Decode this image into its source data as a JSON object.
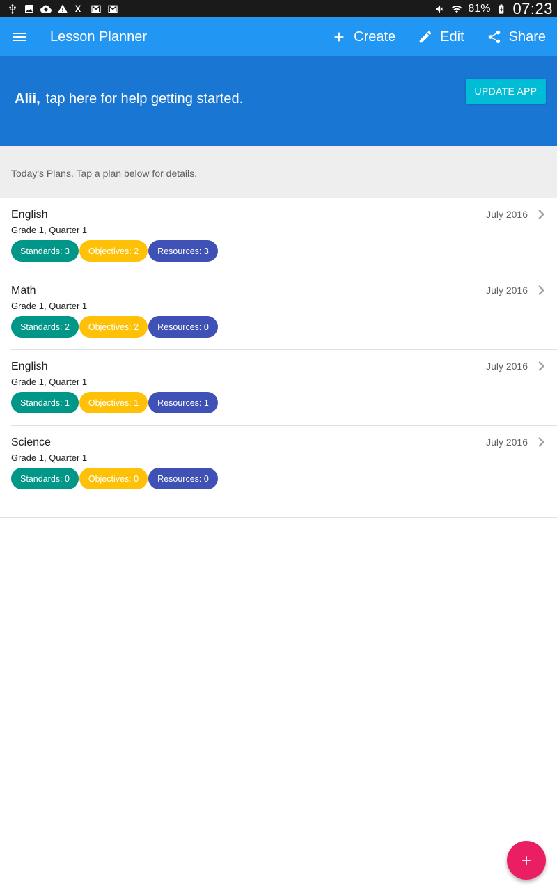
{
  "status_bar": {
    "left_icons": [
      "usb-icon",
      "image-icon",
      "cloud-upload-icon",
      "warning-icon",
      "data-off-icon",
      "gmail-icon",
      "gmail-icon"
    ],
    "right_icons": [
      "mute-icon",
      "wifi-icon",
      "battery-charging-icon"
    ],
    "battery": "81%",
    "time": "07:23"
  },
  "app_bar": {
    "title": "Lesson Planner",
    "actions": {
      "create": "Create",
      "edit": "Edit",
      "share": "Share"
    },
    "color": "#2196f3"
  },
  "banner": {
    "name": "Alii,",
    "message": "tap here for help getting started.",
    "update_button": "UPDATE APP",
    "color": "#1976d2",
    "button_color": "#00bcd4"
  },
  "section": {
    "header": "Today's Plans. Tap a plan below for details."
  },
  "plans": [
    {
      "subject": "English",
      "grade": "Grade 1, Quarter 1",
      "date": "July 2016",
      "standards": "Standards: 3",
      "objectives": "Objectives: 2",
      "resources": "Resources: 3"
    },
    {
      "subject": "Math",
      "grade": "Grade 1, Quarter 1",
      "date": "July 2016",
      "standards": "Standards: 2",
      "objectives": "Objectives: 2",
      "resources": "Resources: 0"
    },
    {
      "subject": "English",
      "grade": "Grade 1, Quarter 1",
      "date": "July 2016",
      "standards": "Standards: 1",
      "objectives": "Objectives: 1",
      "resources": "Resources: 1"
    },
    {
      "subject": "Science",
      "grade": "Grade 1, Quarter 1",
      "date": "July 2016",
      "standards": "Standards: 0",
      "objectives": "Objectives: 0",
      "resources": "Resources: 0"
    }
  ],
  "chip_colors": {
    "standards": "#009688",
    "objectives": "#ffc107",
    "resources": "#3f51b5"
  },
  "fab": {
    "icon": "plus-icon",
    "color": "#e91e63"
  }
}
